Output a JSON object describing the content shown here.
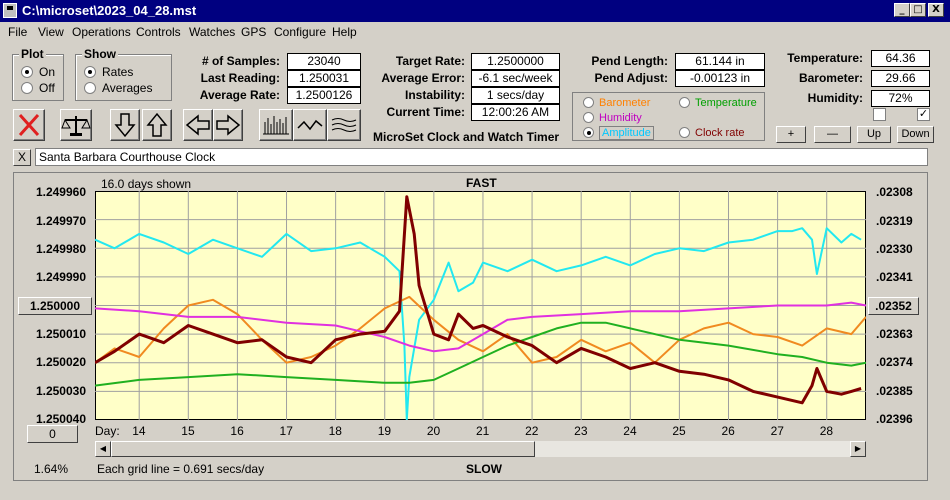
{
  "window": {
    "title": "C:\\microset\\2023_04_28.mst",
    "buttons": {
      "minimize": "_",
      "maximize": "□",
      "close": "X"
    }
  },
  "menu": [
    "File",
    "View",
    "Operations",
    "Controls",
    "Watches",
    "GPS",
    "Configure",
    "Help"
  ],
  "plot_group": {
    "title": "Plot",
    "options": [
      "On",
      "Off"
    ],
    "selected": "On"
  },
  "show_group": {
    "title": "Show",
    "options": [
      "Rates",
      "Averages"
    ],
    "selected": "Rates"
  },
  "stats": {
    "samples_label": "# of Samples:",
    "samples": "23040",
    "last_reading_label": "Last Reading:",
    "last_reading": "1.250031",
    "average_rate_label": "Average Rate:",
    "average_rate": "1.2500126",
    "target_rate_label": "Target Rate:",
    "target_rate": "1.2500000",
    "average_error_label": "Average Error:",
    "average_error": "-6.1 sec/week",
    "instability_label": "Instability:",
    "instability": "1 secs/day",
    "current_time_label": "Current Time:",
    "current_time": "12:00:26 AM",
    "pend_length_label": "Pend Length:",
    "pend_length": "61.144 in",
    "pend_adjust_label": "Pend Adjust:",
    "pend_adjust": "-0.00123 in",
    "temperature_label": "Temperature:",
    "temperature": "64.36",
    "barometer_label": "Barometer:",
    "barometer": "29.66",
    "humidity_label": "Humidity:",
    "humidity": "72%"
  },
  "app_heading": "MicroSet Clock and Watch Timer",
  "legend": {
    "items": [
      {
        "label": "Barometer",
        "color": "#ff8000"
      },
      {
        "label": "Temperature",
        "color": "#00a000"
      },
      {
        "label": "Humidity",
        "color": "#c000c0"
      },
      {
        "label": "Amplitude",
        "color": "#00c8ff"
      },
      {
        "label": "Clock rate",
        "color": "#800000"
      }
    ],
    "selected": "Amplitude"
  },
  "scale_buttons": {
    "plus": "+",
    "minus": "—",
    "up": "Up",
    "down": "Down"
  },
  "checkboxes": [
    {
      "checked": false
    },
    {
      "checked": true
    }
  ],
  "clock_name": "Santa Barbara Courthouse Clock",
  "name_close": "X",
  "chart_labels": {
    "days_shown": "16.0 days shown",
    "fast": "FAST",
    "slow": "SLOW",
    "grid_note": "Each grid line = 0.691 secs/day",
    "percent": "1.64%",
    "zero_button": "0",
    "day_prefix": "Day:"
  },
  "chart_data": {
    "type": "line",
    "x_label": "Day:",
    "x_ticks": [
      "14",
      "15",
      "16",
      "17",
      "18",
      "19",
      "20",
      "21",
      "22",
      "23",
      "24",
      "25",
      "26",
      "27",
      "28"
    ],
    "y_left_ticks": [
      "1.249960",
      "1.249970",
      "1.249980",
      "1.249990",
      "1.250000",
      "1.250010",
      "1.250020",
      "1.250030",
      "1.250040"
    ],
    "y_left_range": [
      1.24996,
      1.25004
    ],
    "y_left_inverted": true,
    "y_right_ticks": [
      ".02308",
      ".02319",
      ".02330",
      ".02341",
      ".02352",
      ".02363",
      ".02374",
      ".02385",
      ".02396"
    ],
    "highlighted_ticks": {
      "left": "1.250000",
      "right": ".02352"
    },
    "x_range": [
      13.1,
      28.8
    ],
    "grid": true,
    "series": [
      {
        "name": "Amplitude",
        "color": "#22e8f0",
        "x": [
          13.1,
          13.5,
          14.0,
          14.5,
          15.0,
          15.5,
          16.0,
          16.5,
          17.0,
          17.5,
          18.0,
          18.5,
          19.0,
          19.3,
          19.4,
          19.45,
          19.5,
          19.7,
          20.0,
          20.3,
          20.5,
          20.8,
          21.0,
          21.5,
          22.0,
          22.5,
          23.0,
          23.5,
          24.0,
          24.5,
          25.0,
          25.5,
          26.0,
          26.5,
          27.0,
          27.3,
          27.5,
          27.7,
          27.8,
          28.0,
          28.3,
          28.5,
          28.7
        ],
        "y": [
          1.249977,
          1.24998,
          1.249975,
          1.249978,
          1.249982,
          1.249977,
          1.24998,
          1.249983,
          1.249975,
          1.249981,
          1.24998,
          1.249978,
          1.249983,
          1.249988,
          1.250014,
          1.25004,
          1.250025,
          1.250005,
          1.249998,
          1.249985,
          1.249995,
          1.249992,
          1.249985,
          1.249988,
          1.249984,
          1.249988,
          1.249986,
          1.249983,
          1.249986,
          1.249982,
          1.24998,
          1.249981,
          1.249978,
          1.249977,
          1.249974,
          1.249974,
          1.249973,
          1.249977,
          1.249989,
          1.249973,
          1.249978,
          1.249975,
          1.249977
        ]
      },
      {
        "name": "Barometer",
        "color": "#f08a20",
        "x": [
          13.1,
          13.5,
          14.0,
          14.5,
          15.0,
          15.5,
          16.0,
          16.5,
          17.0,
          17.5,
          18.0,
          18.5,
          19.0,
          19.5,
          20.0,
          20.5,
          21.0,
          21.5,
          22.0,
          22.5,
          23.0,
          23.5,
          24.0,
          24.5,
          25.0,
          25.5,
          26.0,
          26.5,
          27.0,
          27.5,
          28.0,
          28.5,
          28.8
        ],
        "y": [
          1.25002,
          1.250015,
          1.250018,
          1.250008,
          1.25,
          1.249998,
          1.250003,
          1.250012,
          1.25002,
          1.250018,
          1.250014,
          1.250008,
          1.250001,
          1.249997,
          1.250005,
          1.250012,
          1.250016,
          1.25001,
          1.25002,
          1.250018,
          1.250012,
          1.250016,
          1.250013,
          1.25002,
          1.250012,
          1.250008,
          1.250006,
          1.25001,
          1.250011,
          1.250014,
          1.250008,
          1.25001,
          1.250004
        ]
      },
      {
        "name": "Humidity",
        "color": "#e030e0",
        "x": [
          13.1,
          14.0,
          15.0,
          16.0,
          17.0,
          18.0,
          18.5,
          19.0,
          19.5,
          20.0,
          20.5,
          21.0,
          21.5,
          22.0,
          23.0,
          24.0,
          25.0,
          26.0,
          27.0,
          28.0,
          28.5,
          28.8
        ],
        "y": [
          1.250001,
          1.250002,
          1.250004,
          1.250004,
          1.250006,
          1.250007,
          1.250009,
          1.250011,
          1.250014,
          1.250016,
          1.250015,
          1.25001,
          1.250005,
          1.250004,
          1.250003,
          1.250002,
          1.250002,
          1.250001,
          1.25,
          1.25,
          1.249999,
          1.25
        ]
      },
      {
        "name": "Temperature",
        "color": "#20b020",
        "x": [
          13.1,
          14.0,
          15.0,
          16.0,
          17.0,
          18.0,
          19.0,
          19.5,
          20.0,
          20.5,
          21.0,
          21.5,
          22.0,
          22.5,
          23.0,
          23.5,
          24.0,
          25.0,
          26.0,
          27.0,
          27.5,
          28.0,
          28.5,
          28.8
        ],
        "y": [
          1.250028,
          1.250026,
          1.250025,
          1.250024,
          1.250025,
          1.250026,
          1.250027,
          1.250027,
          1.250026,
          1.250022,
          1.250018,
          1.250014,
          1.250011,
          1.250008,
          1.250006,
          1.250006,
          1.250008,
          1.250012,
          1.250014,
          1.250017,
          1.250018,
          1.25002,
          1.250021,
          1.25002
        ]
      },
      {
        "name": "Clock rate",
        "color": "#800000",
        "x": [
          13.1,
          13.5,
          14.0,
          14.5,
          15.0,
          15.5,
          16.0,
          16.5,
          17.0,
          17.5,
          18.0,
          18.5,
          19.0,
          19.3,
          19.45,
          19.6,
          19.7,
          20.0,
          20.3,
          20.5,
          20.8,
          21.0,
          21.5,
          22.0,
          22.5,
          23.0,
          23.5,
          24.0,
          24.5,
          25.0,
          25.5,
          26.0,
          26.5,
          27.0,
          27.5,
          27.7,
          27.8,
          28.0,
          28.3,
          28.5,
          28.7
        ],
        "y": [
          1.25002,
          1.250016,
          1.25001,
          1.250013,
          1.250007,
          1.25001,
          1.250013,
          1.250012,
          1.250018,
          1.25002,
          1.250012,
          1.25001,
          1.250009,
          1.250002,
          1.249962,
          1.249975,
          1.249993,
          1.25001,
          1.250012,
          1.250003,
          1.250008,
          1.250007,
          1.250011,
          1.250014,
          1.25002,
          1.250015,
          1.250018,
          1.250022,
          1.25002,
          1.250023,
          1.250024,
          1.250026,
          1.25003,
          1.250032,
          1.250034,
          1.250028,
          1.250022,
          1.25003,
          1.250031,
          1.25003,
          1.250029
        ]
      }
    ]
  }
}
